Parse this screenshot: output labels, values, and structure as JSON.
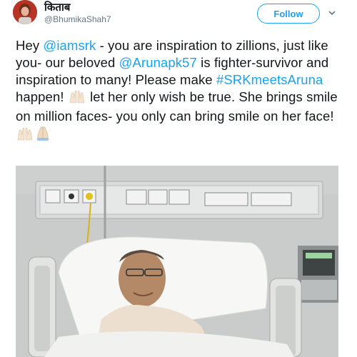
{
  "header": {
    "display_name": "किताब",
    "handle": "@BhumikaShah7",
    "follow_label": "Follow"
  },
  "tweet": {
    "t1": "Hey ",
    "m1": "@iamsrk",
    "t2": " - you are inspiration to zillions, just like you- our beloved ",
    "m2": "@Arunapk57",
    "t3": " is fighter-survivor and inspiration to many! Please make ",
    "h1": "#SRKmeetsAruna",
    "t4": " happen! ",
    "t5": " let her only wish be true. She brings smile on million faces- you only can bring smile on her face! "
  },
  "colors": {
    "link": "#1da1f2",
    "text": "#14171a",
    "muted": "#657786"
  },
  "icons": {
    "avatar": "profile-avatar",
    "caret": "chevron-down-icon",
    "emoji_1": "raised-hands-emoji",
    "emoji_2": "raised-hands-emoji",
    "emoji_3": "folded-hands-emoji"
  }
}
